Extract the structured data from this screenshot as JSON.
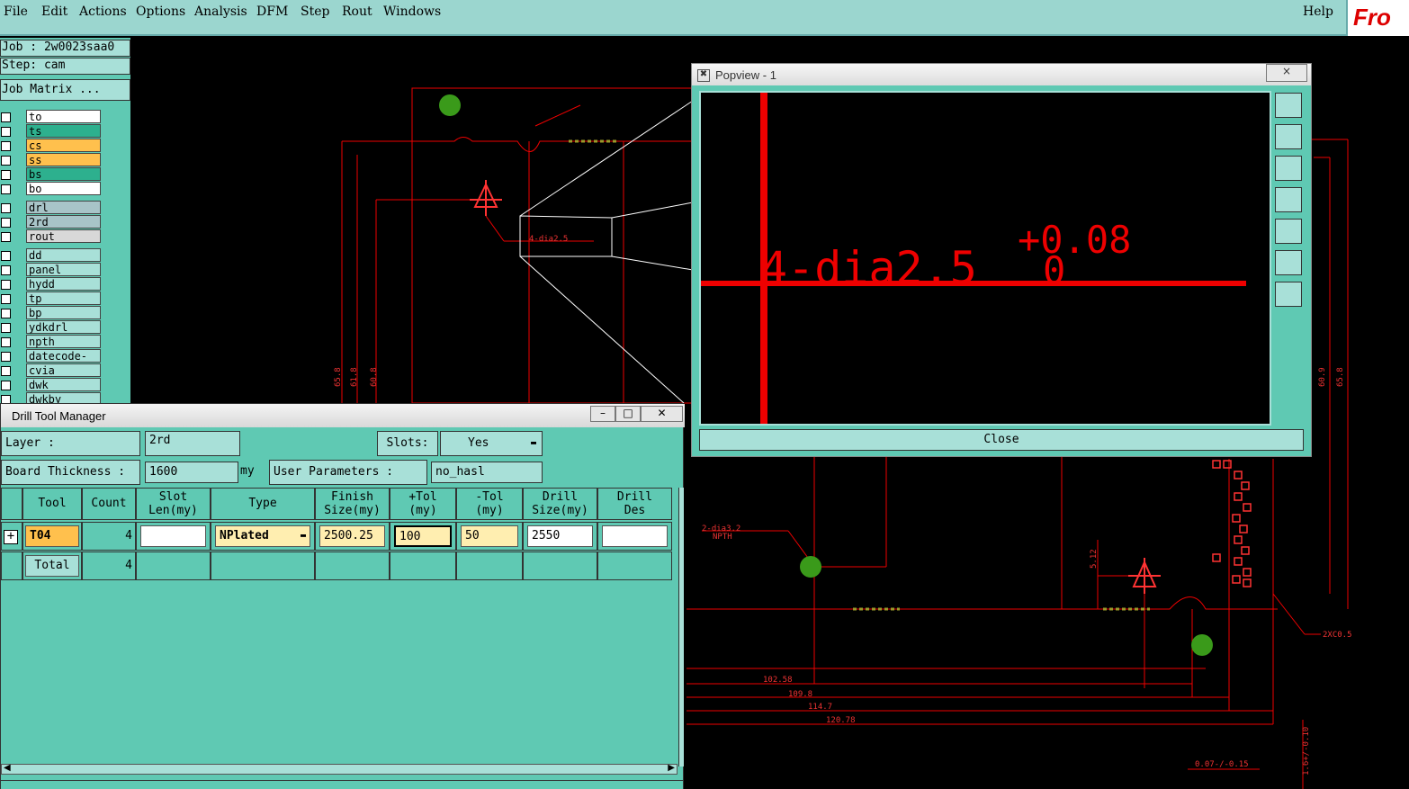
{
  "menubar": {
    "items": [
      {
        "label": "File"
      },
      {
        "label": "Edit"
      },
      {
        "label": "Actions"
      },
      {
        "label": "Options"
      },
      {
        "label": "Analysis"
      },
      {
        "label": "DFM"
      },
      {
        "label": "Step"
      },
      {
        "label": "Rout"
      },
      {
        "label": "Windows"
      }
    ],
    "help": "Help",
    "logo": "Fro"
  },
  "leftpanel": {
    "job": "Job : 2w0023saa0",
    "step": "Step: cam",
    "job_matrix": "Job Matrix ...",
    "layers": [
      {
        "name": "to",
        "color": "#ffffff"
      },
      {
        "name": "ts",
        "color": "#2db08e"
      },
      {
        "name": "cs",
        "color": "#ffc04d"
      },
      {
        "name": "ss",
        "color": "#ffc04d"
      },
      {
        "name": "bs",
        "color": "#2db08e"
      },
      {
        "name": "bo",
        "color": "#ffffff"
      },
      {
        "name": "drl",
        "color": "#a8c4c8"
      },
      {
        "name": "2rd",
        "color": "#a8c4c8"
      },
      {
        "name": "rout",
        "color": "#d8d8d8"
      },
      {
        "name": "dd",
        "color": "#a8e0d8"
      },
      {
        "name": "panel",
        "color": "#a8e0d8"
      },
      {
        "name": "hydd",
        "color": "#a8e0d8"
      },
      {
        "name": "tp",
        "color": "#a8e0d8"
      },
      {
        "name": "bp",
        "color": "#a8e0d8"
      },
      {
        "name": "ydkdrl",
        "color": "#a8e0d8"
      },
      {
        "name": "npth",
        "color": "#a8e0d8"
      },
      {
        "name": "datecode-pt",
        "color": "#a8e0d8"
      },
      {
        "name": "cvia",
        "color": "#a8e0d8"
      },
      {
        "name": "dwk",
        "color": "#a8e0d8"
      },
      {
        "name": "dwkby",
        "color": "#a8e0d8"
      }
    ]
  },
  "dtm": {
    "title": "Drill Tool Manager",
    "layer_label": "Layer           :",
    "layer_value": "2rd",
    "slots_label": "Slots:",
    "slots_value": "Yes",
    "board_label": "Board Thickness :",
    "board_value": "1600",
    "board_unit": "my",
    "user_params_label": "User Parameters :",
    "user_params_value": "no_hasl",
    "columns": [
      {
        "l1": "Tool",
        "l2": ""
      },
      {
        "l1": "Count",
        "l2": ""
      },
      {
        "l1": "Slot",
        "l2": "Len(my)"
      },
      {
        "l1": "Type",
        "l2": ""
      },
      {
        "l1": "Finish",
        "l2": "Size(my)"
      },
      {
        "l1": "+Tol",
        "l2": "(my)"
      },
      {
        "l1": "-Tol",
        "l2": "(my)"
      },
      {
        "l1": "Drill",
        "l2": "Size(my)"
      },
      {
        "l1": "Drill",
        "l2": "Des"
      }
    ],
    "row": {
      "tool": "T04",
      "count": "4",
      "slot_len": "",
      "type": "NPlated",
      "finish": "2500.25",
      "ptol": "100",
      "mtol": "50",
      "drill": "2550",
      "des": ""
    },
    "total_label": "Total",
    "total_count": "4"
  },
  "popview": {
    "title": "Popview - 1",
    "text_main": "4-dia2.5",
    "text_sup": "+0.08",
    "text_sub": "0",
    "close": "Close",
    "close_glyph": "×"
  },
  "cad": {
    "note1": "4-dia2.5",
    "note2": "2-dia3.2",
    "note2_sub": "NPTH",
    "dim1": "102.58",
    "dim2": "109.8",
    "dim3": "114.7",
    "dim4": "120.78",
    "dim5": "2XC0.5",
    "dim6": "0.07-/-0.15",
    "v1": "65.8",
    "v2": "61.8",
    "v3": "60.8",
    "v4": "60.9",
    "v5": "65.8",
    "v6": "5.12",
    "v7": "1.6+/-0.10"
  }
}
